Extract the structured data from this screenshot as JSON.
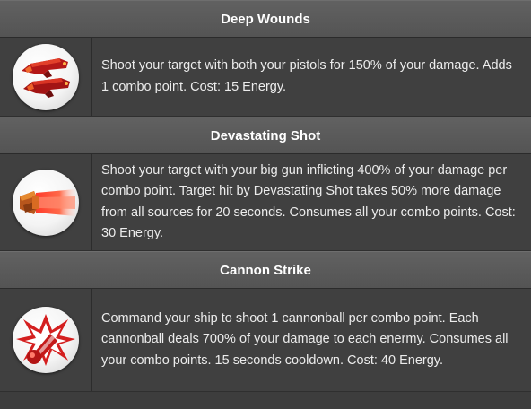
{
  "skills": [
    {
      "name": "Deep Wounds",
      "description": "Shoot your target with both your pistols for 150% of your damage. Adds 1 combo point. Cost: 15 Energy.",
      "icon": "twin-pistols-icon"
    },
    {
      "name": "Devastating Shot",
      "description": "Shoot your target with your big gun inflicting 400% of your damage per combo point. Target hit by Devastating Shot takes 50% more damage from all sources for 20 seconds. Consumes all your combo points. Cost: 30 Energy.",
      "icon": "big-gun-blast-icon"
    },
    {
      "name": "Cannon Strike",
      "description": "Command your ship to shoot 1 cannonball per combo point. Each cannonball deals 700% of your damage to each enermy. Consumes all your combo points. 15 seconds cooldown. Cost: 40 Energy.",
      "icon": "cannonball-impact-icon"
    }
  ],
  "colors": {
    "header_bg": "#5a5a5a",
    "body_bg": "#404040",
    "text": "#ececec",
    "icon_accent": "#c81e1e"
  }
}
